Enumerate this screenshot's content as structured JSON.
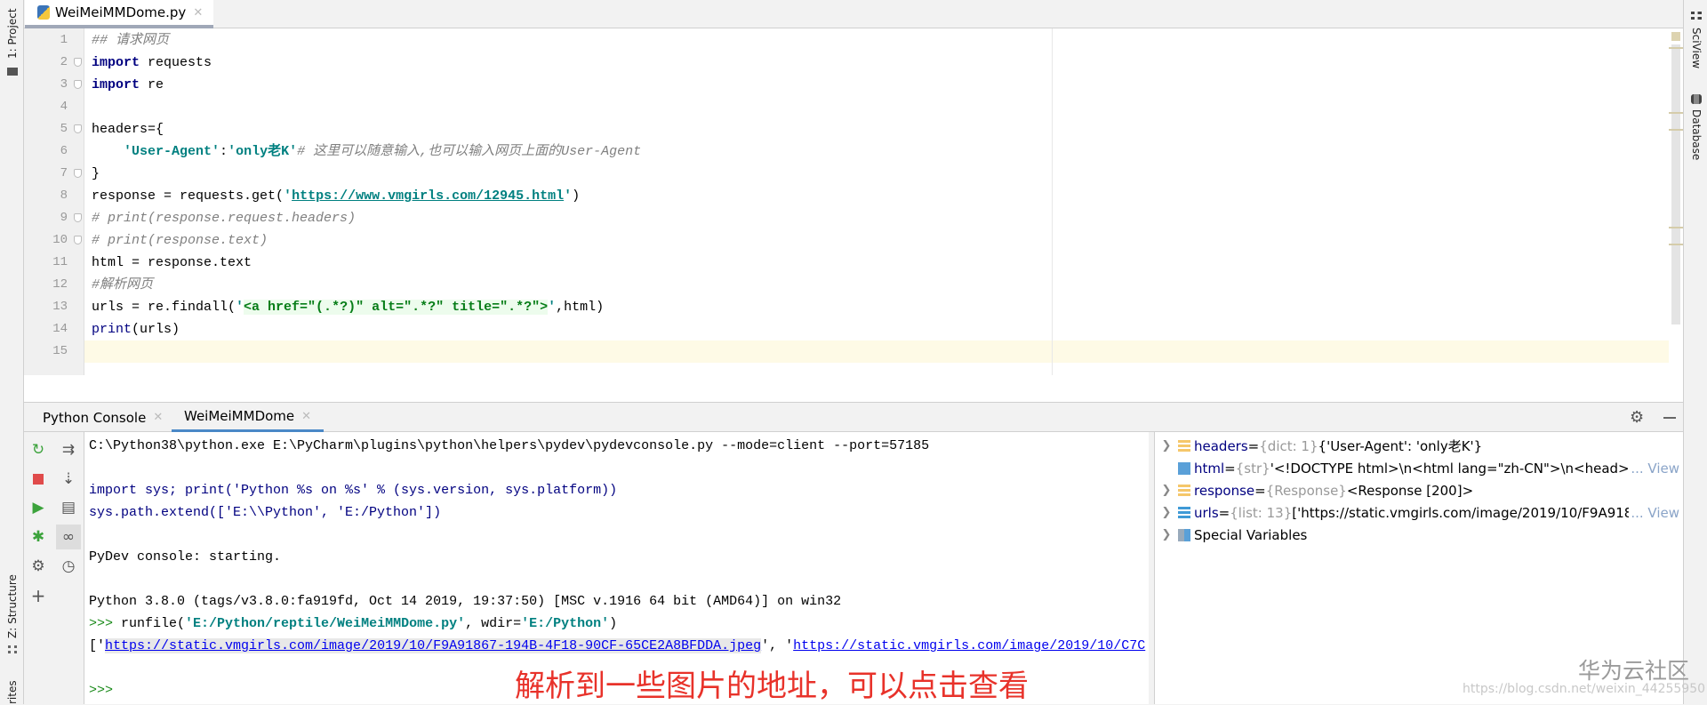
{
  "left_strip": {
    "project_label": "1: Project",
    "structure_label": "Z: Structure",
    "favorites_label": "rites"
  },
  "right_strip": {
    "sciview_label": "SciView",
    "database_label": "Database"
  },
  "editor": {
    "tab_label": "WeiMeiMMDome.py",
    "current_line": 15,
    "lines": [
      [
        {
          "t": "## 请求网页",
          "c": "cm"
        }
      ],
      [
        {
          "t": "import",
          "c": "kw"
        },
        {
          "t": " requests",
          "c": "pl"
        }
      ],
      [
        {
          "t": "import",
          "c": "kw"
        },
        {
          "t": " re",
          "c": "pl"
        }
      ],
      [],
      [
        {
          "t": "headers={",
          "c": "pl"
        }
      ],
      [
        {
          "t": "    ",
          "c": "pl"
        },
        {
          "t": "'User-Agent'",
          "c": "str"
        },
        {
          "t": ":",
          "c": "pl"
        },
        {
          "t": "'only老K'",
          "c": "str"
        },
        {
          "t": "# 这里可以随意输入,也可以输入网页上面的User-Agent",
          "c": "cm"
        }
      ],
      [
        {
          "t": "}",
          "c": "pl"
        }
      ],
      [
        {
          "t": "response = requests.get(",
          "c": "pl"
        },
        {
          "t": "'",
          "c": "str"
        },
        {
          "t": "https://www.vmgirls.com/12945.html",
          "c": "url"
        },
        {
          "t": "'",
          "c": "str"
        },
        {
          "t": ")",
          "c": "pl"
        }
      ],
      [
        {
          "t": "# print(response.request.headers)",
          "c": "cm"
        }
      ],
      [
        {
          "t": "# print(response.text)",
          "c": "cm"
        }
      ],
      [
        {
          "t": "html = response.text",
          "c": "pl"
        }
      ],
      [
        {
          "t": "#解析网页",
          "c": "cm"
        }
      ],
      [
        {
          "t": "urls = re.findall(",
          "c": "pl"
        },
        {
          "t": "'",
          "c": "str"
        },
        {
          "t": "<a href=\"(.*?)\" alt=\".*?\" title=\".*?\">",
          "c": "rx"
        },
        {
          "t": "'",
          "c": "str"
        },
        {
          "t": ",html)",
          "c": "pl"
        }
      ],
      [
        {
          "t": "print",
          "c": "fn"
        },
        {
          "t": "(urls)",
          "c": "pl"
        }
      ],
      []
    ]
  },
  "tool_window": {
    "tabs": [
      {
        "label": "Python Console",
        "active": false
      },
      {
        "label": "WeiMeiMMDome",
        "active": true
      }
    ],
    "accent": "#4a88c7"
  },
  "console": {
    "lines": [
      [
        {
          "t": "C:\\Python38\\python.exe E:\\PyCharm\\plugins\\python\\helpers\\pydev\\pydevconsole.py --mode=client --port=57185",
          "c": "pl"
        }
      ],
      [],
      [
        {
          "t": "import sys; print('Python %s on %s' % (sys.version, sys.platform))",
          "c": "fn"
        }
      ],
      [
        {
          "t": "sys.path.extend(['E:\\\\Python', 'E:/Python'])",
          "c": "fn"
        }
      ],
      [],
      [
        {
          "t": "PyDev console: starting.",
          "c": "pl"
        }
      ],
      [],
      [
        {
          "t": "Python 3.8.0 (tags/v3.8.0:fa919fd, Oct 14 2019, 19:37:50) [MSC v.1916 64 bit (AMD64)] on win32",
          "c": "pl"
        }
      ],
      [
        {
          "t": ">>> ",
          "c": "prompt"
        },
        {
          "t": "runfile(",
          "c": "pl"
        },
        {
          "t": "'E:/Python/reptile/WeiMeiMMDome.py'",
          "c": "str"
        },
        {
          "t": ", wdir=",
          "c": "pl"
        },
        {
          "t": "'E:/Python'",
          "c": "str"
        },
        {
          "t": ")",
          "c": "pl"
        }
      ],
      [
        {
          "t": "['",
          "c": "pl"
        },
        {
          "t": "https://static.vmgirls.com/image/2019/10/F9A91867-194B-4F18-90CF-65CE2A8BFDDA.jpeg",
          "c": "clinkh"
        },
        {
          "t": "', '",
          "c": "pl"
        },
        {
          "t": "https://static.vmgirls.com/image/2019/10/C7C",
          "c": "clink"
        }
      ],
      [],
      [
        {
          "t": ">>>",
          "c": "prompt"
        }
      ]
    ]
  },
  "variables": [
    {
      "name": "headers",
      "type": "{dict: 1}",
      "value": "{'User-Agent': 'only老K'}",
      "icon": "dict-icon",
      "expandable": true,
      "view": ""
    },
    {
      "name": "html",
      "type": "{str}",
      "value": "'<!DOCTYPE html>\\n<html lang=\"zh-CN\">\\n<head>\\n",
      "icon": "str-icon",
      "expandable": false,
      "view": "... View"
    },
    {
      "name": "response",
      "type": "{Response}",
      "value": "<Response [200]>",
      "icon": "object-icon",
      "expandable": true,
      "view": ""
    },
    {
      "name": "urls",
      "type": "{list: 13}",
      "value": "['https://static.vmgirls.com/image/2019/10/F9A9186",
      "icon": "list-icon",
      "expandable": true,
      "view": "... View"
    },
    {
      "name": "Special Variables",
      "type": "",
      "value": "",
      "icon": "special-variables-icon",
      "expandable": true,
      "view": ""
    }
  ],
  "annotation": "解析到一些图片的地址，可以点击查看",
  "watermark": {
    "brand": "华为云社区",
    "url": "https://blog.csdn.net/weixin_44255950"
  }
}
